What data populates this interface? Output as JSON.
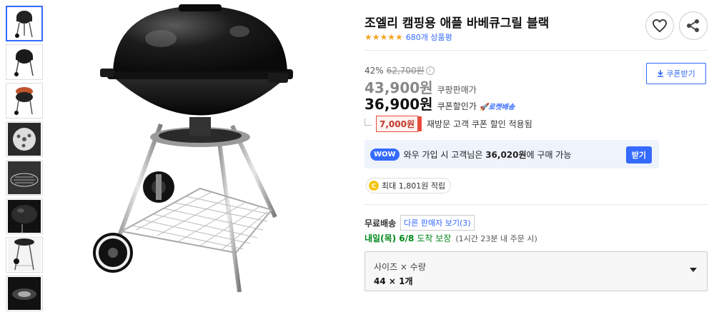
{
  "thumbnails": [
    {
      "name": "thumb-grill-front",
      "active": true
    },
    {
      "name": "thumb-grill-alt"
    },
    {
      "name": "thumb-grill-open"
    },
    {
      "name": "thumb-grill-vent"
    },
    {
      "name": "thumb-grill-grate"
    },
    {
      "name": "thumb-grill-lid"
    },
    {
      "name": "thumb-grill-legs"
    },
    {
      "name": "thumb-grill-bottom"
    }
  ],
  "product": {
    "title": "조엘리 캠핑용 애플 바베큐그릴 블랙",
    "rating_value": 4.5,
    "stars": "★★★★★",
    "review_count": "680개 상품평"
  },
  "price": {
    "discount_rate": "42%",
    "original_price": "62,700원",
    "sale_price": "43,900원",
    "sale_label": "쿠팡판매가",
    "coupon_price": "36,900원",
    "coupon_label": "쿠폰할인가",
    "rocket_label": "🚀로켓배송",
    "coupon_button": "쿠폰받기",
    "revisit_amount": "7,000원",
    "revisit_text": "재방문 고객 쿠폰 할인 적용됨"
  },
  "wow": {
    "badge": "WOW",
    "text_prefix": "와우 가입 시 고객님은",
    "price": "36,020원",
    "text_suffix": "에 구매 가능",
    "button": "받기"
  },
  "points": {
    "coin": "C",
    "text": "최대 1,801원 적립"
  },
  "shipping": {
    "label": "무료배송",
    "other_sellers": "다른 판매자 보기(3)",
    "delivery_date": "내일(목) 6/8",
    "guarantee": "도착 보장",
    "cutoff": "(1시간 23분 내 주문 시)"
  },
  "option": {
    "header": "사이즈 × 수량",
    "value": "44 × 1개"
  },
  "colors": {
    "accent": "#346aff",
    "star": "#f5a623",
    "delivery": "#00891a",
    "revisit": "#e74c3c"
  }
}
